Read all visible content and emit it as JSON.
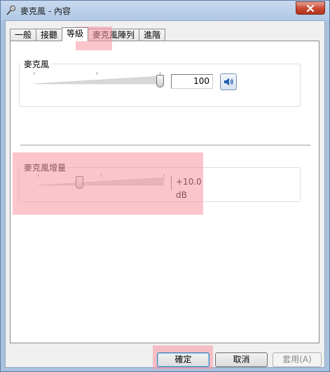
{
  "window": {
    "title": "麥克風 - 內容",
    "close_icon": "close-icon"
  },
  "tabs": [
    {
      "label": "一般",
      "active": false
    },
    {
      "label": "接聽",
      "active": false
    },
    {
      "label": "等級",
      "active": true
    },
    {
      "label": "麥克風陣列",
      "active": false
    },
    {
      "label": "進階",
      "active": false
    }
  ],
  "microphone": {
    "label": "麥克風",
    "level_percent": 100,
    "value": "100",
    "mute_icon": "speaker-icon"
  },
  "boost": {
    "label": "麥克風增量",
    "level_fraction": 0.33,
    "value": "+10.0 dB"
  },
  "buttons": {
    "ok": "確定",
    "cancel": "取消",
    "apply": "套用(A)"
  },
  "colors": {
    "highlight": "#fa96a0",
    "titlebar": "#b1c8e4",
    "close": "#c9472f"
  }
}
